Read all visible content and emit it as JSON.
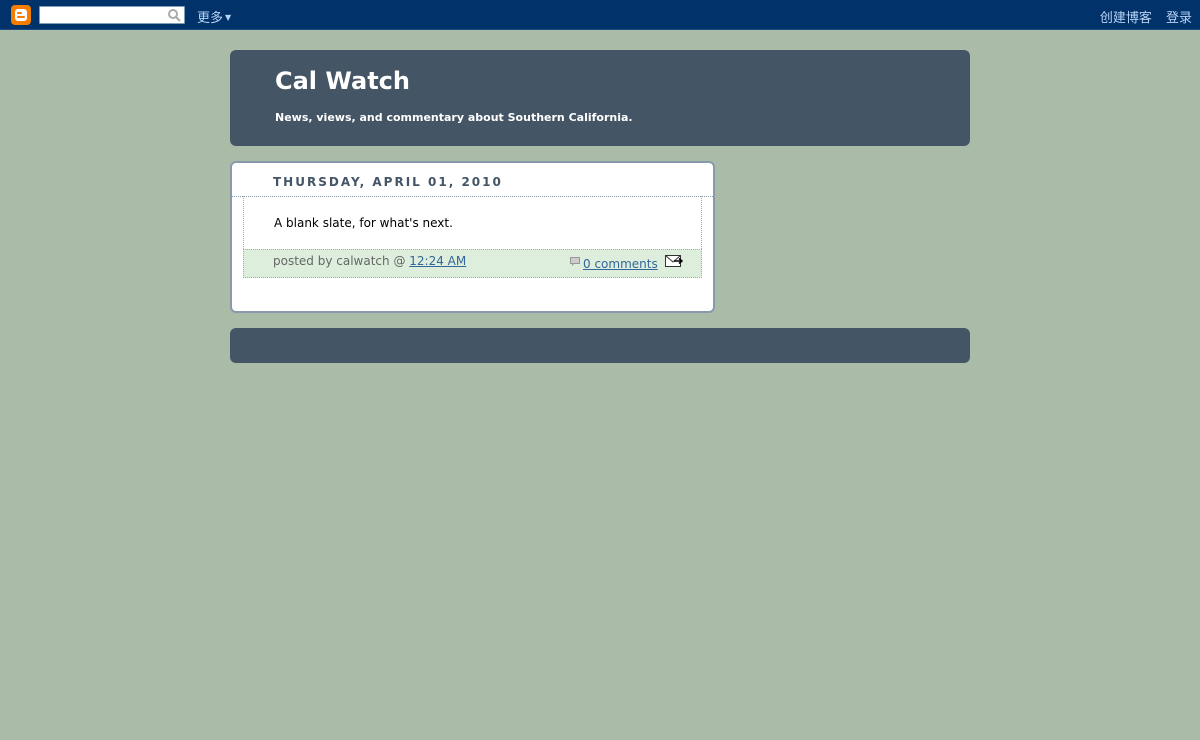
{
  "navbar": {
    "search_placeholder": "",
    "more_label": "更多",
    "create_blog": "创建博客",
    "sign_in": "登录"
  },
  "header": {
    "title": "Cal Watch",
    "description": "News, views, and commentary about Southern California."
  },
  "post": {
    "date": "Thursday, April 01, 2010",
    "body": "A blank slate, for what's next.",
    "posted_by_prefix": "posted by calwatch @ ",
    "time": "12:24 AM",
    "comments": "0 comments"
  },
  "colors": {
    "page_bg": "#aabba8",
    "navbar_bg": "#01336a",
    "header_bg": "#445566",
    "footer_bg": "#ddeedd",
    "link": "#336699"
  }
}
